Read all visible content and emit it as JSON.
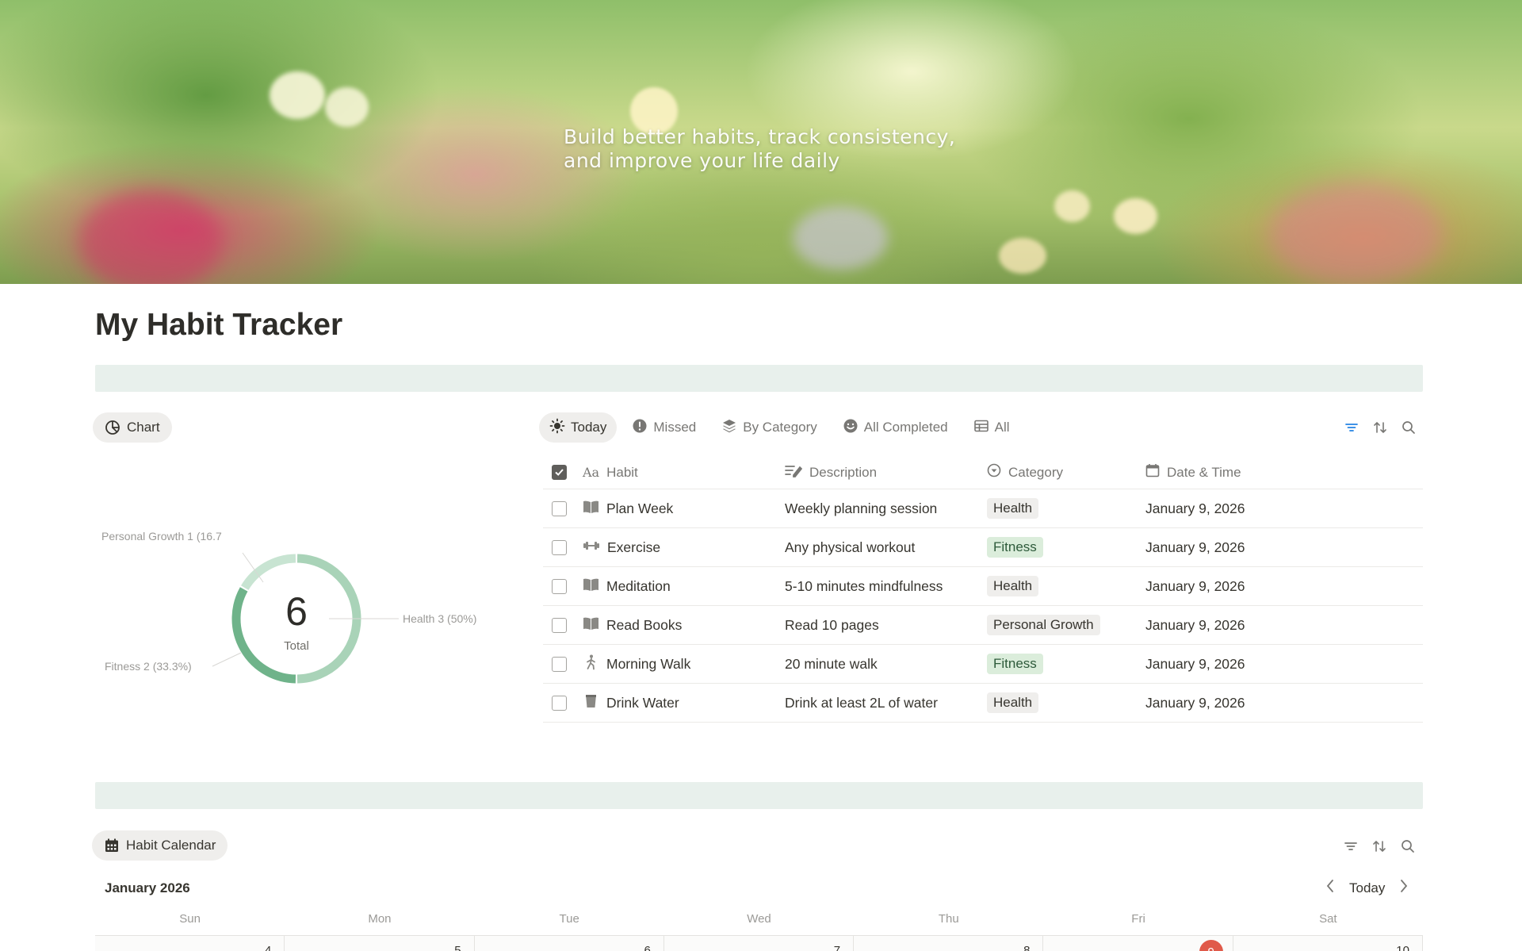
{
  "cover": {
    "tagline_line1": "Build better habits, track consistency,",
    "tagline_line2": "and improve your life daily"
  },
  "page": {
    "title": "My Habit Tracker"
  },
  "chart_view": {
    "label": "Chart"
  },
  "tabs": [
    {
      "label": "Today",
      "icon": "sun-icon",
      "active": true
    },
    {
      "label": "Missed",
      "icon": "alert-circle-icon",
      "active": false
    },
    {
      "label": "By Category",
      "icon": "layers-icon",
      "active": false
    },
    {
      "label": "All Completed",
      "icon": "smiley-icon",
      "active": false
    },
    {
      "label": "All",
      "icon": "table-icon",
      "active": false
    }
  ],
  "table": {
    "headers": {
      "habit": "Habit",
      "description": "Description",
      "category": "Category",
      "date": "Date & Time"
    },
    "rows": [
      {
        "habit": "Plan Week",
        "icon": "book-icon",
        "description": "Weekly planning session",
        "category": "Health",
        "date": "January 9, 2026"
      },
      {
        "habit": "Exercise",
        "icon": "dumbbell-icon",
        "description": "Any physical workout",
        "category": "Fitness",
        "date": "January 9, 2026"
      },
      {
        "habit": "Meditation",
        "icon": "book-icon",
        "description": "5-10 minutes mindfulness",
        "category": "Health",
        "date": "January 9, 2026"
      },
      {
        "habit": "Read Books",
        "icon": "book-icon",
        "description": "Read 10 pages",
        "category": "Personal Growth",
        "date": "January 9, 2026"
      },
      {
        "habit": "Morning Walk",
        "icon": "walking-icon",
        "description": "20 minute walk",
        "category": "Fitness",
        "date": "January 9, 2026"
      },
      {
        "habit": "Drink Water",
        "icon": "cup-icon",
        "description": "Drink at least 2L of water",
        "category": "Health",
        "date": "January 9, 2026"
      }
    ]
  },
  "chart_data": {
    "type": "pie",
    "center_value": "6",
    "center_label": "Total",
    "categories": [
      "Health",
      "Fitness",
      "Personal Growth"
    ],
    "values": [
      3,
      2,
      1
    ],
    "labels": [
      "Health  3 (50%)",
      "Fitness  2 (33.3%)",
      "Personal Growth  1 (16.7"
    ],
    "colors": [
      "#a9d3b8",
      "#6fb38a",
      "#c8e4d2"
    ]
  },
  "calendar": {
    "label": "Habit Calendar",
    "month": "January 2026",
    "today_label": "Today",
    "weekdays": [
      "Sun",
      "Mon",
      "Tue",
      "Wed",
      "Thu",
      "Fri",
      "Sat"
    ],
    "days": [
      "4",
      "5",
      "6",
      "7",
      "8",
      "9",
      "10"
    ]
  },
  "colors": {
    "accent_blue": "#2383e2",
    "today_red": "#e05a4a",
    "band": "#e8f0ec"
  }
}
